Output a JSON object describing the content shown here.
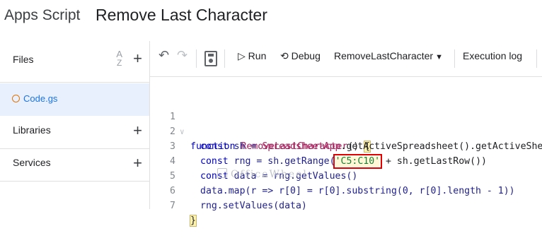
{
  "header": {
    "app_name": "Apps Script",
    "project_name": "Remove Last Character"
  },
  "sidebar": {
    "files_label": "Files",
    "sort_icon_text": {
      "top": "A",
      "bottom": "Z"
    },
    "file_name": "Code.gs",
    "libraries_label": "Libraries",
    "services_label": "Services",
    "plus": "+"
  },
  "toolbar": {
    "undo": "↶",
    "redo": "↷",
    "run_icon": "▷",
    "run_label": "Run",
    "debug_icon": "⟲",
    "debug_label": "Debug",
    "function_select": "RemoveLastCharacter",
    "caret": "▼",
    "execution_log": "Execution log"
  },
  "editor": {
    "line_numbers": [
      "1",
      "2",
      "3",
      "4",
      "5",
      "6",
      "7"
    ],
    "line1": {
      "kw": "function ",
      "fn": "RemoveLastCharacter",
      "rest": "() ",
      "brace": "{"
    },
    "line2": {
      "kw": "const ",
      "name": "sh = ",
      "fn": "SpreadsheetApp",
      "rest": ".getActiveSpreadsheet().getActiveSheet()"
    },
    "line3": {
      "kw": "const ",
      "name": "rng = sh.getRange(",
      "str": "'C5:C10'",
      "rest": " + sh.getLastRow())"
    },
    "line4": {
      "kw": "const ",
      "name": "data = rng.getValues()"
    },
    "line5": {
      "text": "data.map(r => r[0] = r[0].substring(0, r[0].length - 1))"
    },
    "line6": {
      "text": "rng.setValues(data)"
    },
    "line7": {
      "brace": "}"
    }
  },
  "watermark": "OfficeWheel",
  "colors": {
    "highlight_box": "#e00000",
    "selected_file_bg": "#e8f0fe",
    "link_blue": "#1a73e8"
  }
}
